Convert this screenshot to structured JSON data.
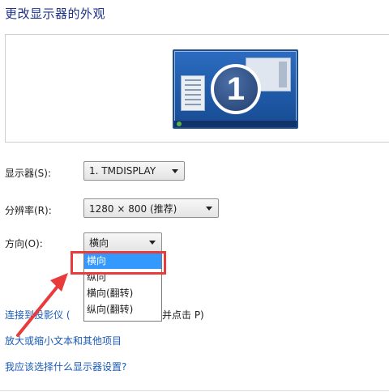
{
  "page": {
    "title": "更改显示器的外观"
  },
  "preview": {
    "monitor_number": "1",
    "icon": "monitor-icon"
  },
  "display": {
    "label": "显示器(S):",
    "value": "1. TMDISPLAY"
  },
  "resolution": {
    "label": "分辨率(R):",
    "value": "1280 × 800 (推荐)"
  },
  "orientation": {
    "label": "方向(O):",
    "value": "横向",
    "options": [
      "横向",
      "纵向",
      "横向(翻转)",
      "纵向(翻转)"
    ],
    "selected_index": 0
  },
  "links": {
    "projector_prefix": "连接到投影仪 (",
    "projector_suffix": "并点击 P)",
    "text_size": "放大或缩小文本和其他项目",
    "help": "我应该选择什么显示器设置?"
  },
  "annotation": {
    "highlight_color": "#e83b3b",
    "arrow_icon": "red-arrow-icon"
  },
  "colors": {
    "title": "#1e3287",
    "link": "#1a5bb8",
    "selection": "#3399ff"
  }
}
